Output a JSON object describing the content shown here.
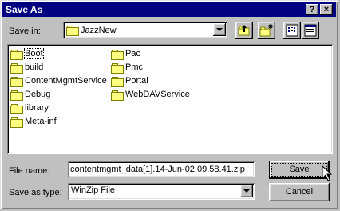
{
  "window": {
    "title": "Save As",
    "help_label": "?",
    "close_label": "×"
  },
  "toolbar": {
    "save_in_label": "Save in:",
    "save_in_value": "JazzNew"
  },
  "folders": [
    {
      "name": "Boot"
    },
    {
      "name": "build"
    },
    {
      "name": "ContentMgmtService"
    },
    {
      "name": "Debug"
    },
    {
      "name": "library"
    },
    {
      "name": "Meta-inf"
    },
    {
      "name": "Pac"
    },
    {
      "name": "Pmc"
    },
    {
      "name": "Portal"
    },
    {
      "name": "WebDAVService"
    }
  ],
  "form": {
    "file_name_label": "File name:",
    "file_name_value": "contentmgmt_data[1].14-Jun-02.09.58.41.zip",
    "save_as_type_label": "Save as type:",
    "save_as_type_value": "WinZip File"
  },
  "buttons": {
    "save_label": "Save",
    "cancel_label": "Cancel"
  },
  "icons": [
    "up-one-level-icon",
    "create-new-folder-icon",
    "list-view-icon",
    "details-view-icon",
    "folder-icon",
    "mouse-cursor-icon"
  ]
}
